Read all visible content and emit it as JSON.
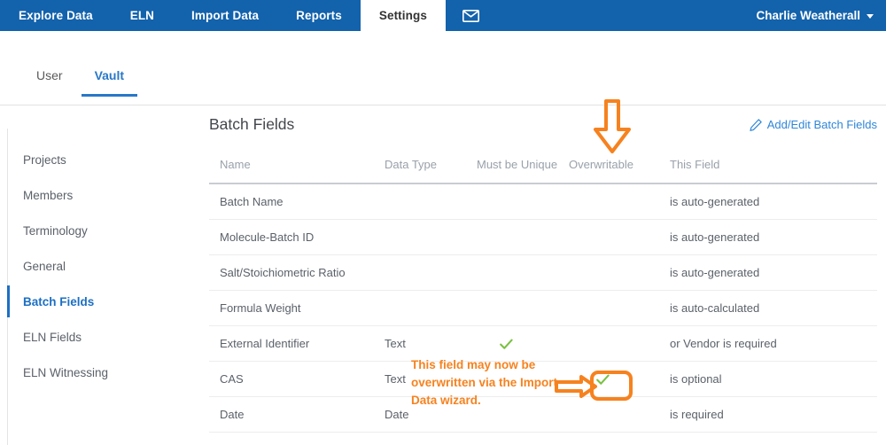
{
  "topnav": {
    "background": "#1362ac",
    "items": [
      {
        "label": "Explore Data",
        "active": false
      },
      {
        "label": "ELN",
        "active": false
      },
      {
        "label": "Import Data",
        "active": false
      },
      {
        "label": "Reports",
        "active": false
      },
      {
        "label": "Settings",
        "active": true
      }
    ],
    "mail_icon": "envelope-icon",
    "user": {
      "name": "Charlie Weatherall",
      "caret": "chevron-down-icon"
    }
  },
  "subtabs": {
    "items": [
      {
        "label": "User",
        "active": false
      },
      {
        "label": "Vault",
        "active": true
      }
    ],
    "active_color": "#2878c8"
  },
  "sidebar": {
    "items": [
      {
        "label": "Projects",
        "active": false
      },
      {
        "label": "Members",
        "active": false
      },
      {
        "label": "Terminology",
        "active": false
      },
      {
        "label": "General",
        "active": false
      },
      {
        "label": "Batch Fields",
        "active": true
      },
      {
        "label": "ELN Fields",
        "active": false
      },
      {
        "label": "ELN Witnessing",
        "active": false
      }
    ],
    "active_color": "#1c6fc4"
  },
  "panel": {
    "title": "Batch Fields",
    "edit_link": {
      "label": "Add/Edit Batch Fields",
      "icon": "pencil-icon",
      "color": "#2f86d8"
    }
  },
  "table": {
    "columns": [
      "Name",
      "Data Type",
      "Must be Unique",
      "Overwritable",
      "This Field"
    ],
    "rows": [
      {
        "name": "Batch Name",
        "type": "",
        "unique": false,
        "overwritable": false,
        "this_field": "is auto-generated"
      },
      {
        "name": "Molecule-Batch ID",
        "type": "",
        "unique": false,
        "overwritable": false,
        "this_field": "is auto-generated"
      },
      {
        "name": "Salt/Stoichiometric Ratio",
        "type": "",
        "unique": false,
        "overwritable": false,
        "this_field": "is auto-generated"
      },
      {
        "name": "Formula Weight",
        "type": "",
        "unique": false,
        "overwritable": false,
        "this_field": "is auto-calculated"
      },
      {
        "name": "External Identifier",
        "type": "Text",
        "unique": true,
        "overwritable": false,
        "this_field": "or Vendor is required"
      },
      {
        "name": "CAS",
        "type": "Text",
        "unique": false,
        "overwritable": true,
        "this_field": "is optional"
      },
      {
        "name": "Date",
        "type": "Date",
        "unique": false,
        "overwritable": false,
        "this_field": "is required"
      }
    ],
    "check_color": "#7ac143"
  },
  "annotations": {
    "color": "#f6821f",
    "arrow_down": "down-arrow-annotation",
    "arrow_right": "right-arrow-annotation",
    "highlight_box": "highlight-box-annotation",
    "callout_text": "This field may now be overwritten via the Import Data wizard."
  }
}
